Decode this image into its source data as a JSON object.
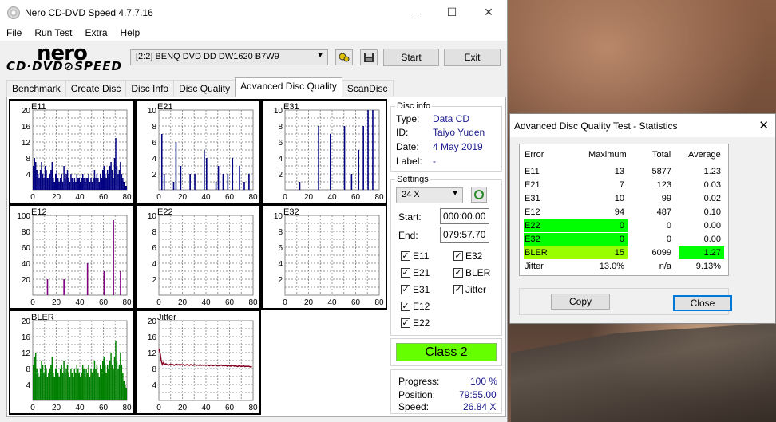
{
  "app": {
    "title": "Nero CD-DVD Speed 4.7.7.16",
    "min": "—",
    "max": "☐",
    "close": "✕"
  },
  "menu": [
    "File",
    "Run Test",
    "Extra",
    "Help"
  ],
  "logo": {
    "top": "nero",
    "bottom": "CD·DVD⊘SPEED"
  },
  "toolbar": {
    "drive": "[2:2]   BENQ DVD DD DW1620 B7W9",
    "start": "Start",
    "exit": "Exit"
  },
  "tabs": [
    "Benchmark",
    "Create Disc",
    "Disc Info",
    "Disc Quality",
    "Advanced Disc Quality",
    "ScanDisc"
  ],
  "active_tab": "Advanced Disc Quality",
  "disc_info": {
    "title": "Disc info",
    "type_label": "Type:",
    "type": "Data CD",
    "id_label": "ID:",
    "id": "Taiyo Yuden",
    "date_label": "Date:",
    "date": "4 May 2019",
    "label_label": "Label:",
    "label": "-"
  },
  "settings": {
    "title": "Settings",
    "speed": "24 X",
    "start_label": "Start:",
    "start": "000:00.00",
    "end_label": "End:",
    "end": "079:57.70",
    "checks": {
      "e11": "E11",
      "e21": "E21",
      "e31": "E31",
      "e12": "E12",
      "e22": "E22",
      "e32": "E32",
      "bler": "BLER",
      "jitter": "Jitter"
    }
  },
  "class_label": "Class 2",
  "progress": {
    "progress_label": "Progress:",
    "progress": "100 %",
    "position_label": "Position:",
    "position": "79:55.00",
    "speed_label": "Speed:",
    "speed": "26.84 X"
  },
  "stats": {
    "title": "Advanced Disc Quality Test - Statistics",
    "headers": [
      "Error",
      "Maximum",
      "Total",
      "Average"
    ],
    "rows": [
      {
        "name": "E11",
        "max": "13",
        "total": "5877",
        "avg": "1.23",
        "hl": ""
      },
      {
        "name": "E21",
        "max": "7",
        "total": "123",
        "avg": "0.03",
        "hl": ""
      },
      {
        "name": "E31",
        "max": "10",
        "total": "99",
        "avg": "0.02",
        "hl": ""
      },
      {
        "name": "E12",
        "max": "94",
        "total": "487",
        "avg": "0.10",
        "hl": ""
      },
      {
        "name": "E22",
        "max": "0",
        "total": "0",
        "avg": "0.00",
        "hl": "name-max"
      },
      {
        "name": "E32",
        "max": "0",
        "total": "0",
        "avg": "0.00",
        "hl": "name-max"
      },
      {
        "name": "BLER",
        "max": "15",
        "total": "6099",
        "avg": "1.27",
        "hl": "bler"
      },
      {
        "name": "Jitter",
        "max": "13.0%",
        "total": "n/a",
        "avg": "9.13%",
        "hl": ""
      }
    ],
    "copy": "Copy",
    "close": "Close"
  },
  "chart_data": [
    {
      "type": "bar",
      "name": "E11",
      "x_ticks": [
        0,
        20,
        40,
        60,
        80
      ],
      "y_ticks": [
        4,
        8,
        12,
        16,
        20
      ],
      "ylim": [
        0,
        20
      ],
      "color": "#000080",
      "values": [
        6,
        8,
        7,
        5,
        4,
        3,
        5,
        7,
        4,
        3,
        6,
        5,
        3,
        3,
        4,
        5,
        7,
        3,
        2,
        4,
        5,
        3,
        2,
        3,
        4,
        2,
        6,
        3,
        4,
        5,
        3,
        2,
        4,
        3,
        2,
        3,
        2,
        4,
        3,
        3,
        2,
        3,
        4,
        3,
        2,
        3,
        3,
        4,
        2,
        3,
        2,
        3,
        5,
        3,
        4,
        3,
        2,
        4,
        3,
        5,
        6,
        4,
        3,
        5,
        4,
        6,
        7,
        5,
        3,
        8,
        13,
        6,
        4,
        5,
        7,
        4,
        3,
        2,
        1,
        1
      ]
    },
    {
      "type": "bar",
      "name": "E21",
      "x_ticks": [
        0,
        20,
        40,
        60,
        80
      ],
      "y_ticks": [
        2,
        4,
        6,
        8,
        10
      ],
      "ylim": [
        0,
        10
      ],
      "color": "#000080",
      "spikes": [
        [
          2,
          7
        ],
        [
          4,
          2
        ],
        [
          12,
          1
        ],
        [
          14,
          6
        ],
        [
          18,
          3
        ],
        [
          26,
          2
        ],
        [
          30,
          2
        ],
        [
          38,
          5
        ],
        [
          40,
          4
        ],
        [
          48,
          1
        ],
        [
          50,
          3
        ],
        [
          54,
          2
        ],
        [
          58,
          2
        ],
        [
          62,
          4
        ],
        [
          68,
          3
        ],
        [
          72,
          1
        ],
        [
          76,
          2
        ]
      ]
    },
    {
      "type": "bar",
      "name": "E31",
      "x_ticks": [
        0,
        20,
        40,
        60,
        80
      ],
      "y_ticks": [
        2,
        4,
        6,
        8,
        10
      ],
      "ylim": [
        0,
        10
      ],
      "color": "#000080",
      "spikes": [
        [
          12,
          1
        ],
        [
          28,
          8
        ],
        [
          38,
          7
        ],
        [
          50,
          8
        ],
        [
          56,
          2
        ],
        [
          62,
          5
        ],
        [
          66,
          8
        ],
        [
          70,
          10
        ],
        [
          74,
          10
        ]
      ]
    },
    {
      "type": "bar",
      "name": "E12",
      "x_ticks": [
        0,
        20,
        40,
        60,
        80
      ],
      "y_ticks": [
        20,
        40,
        60,
        80,
        100
      ],
      "ylim": [
        0,
        100
      ],
      "color": "#800080",
      "spikes": [
        [
          12,
          20
        ],
        [
          26,
          20
        ],
        [
          46,
          40
        ],
        [
          60,
          30
        ],
        [
          68,
          94
        ],
        [
          74,
          30
        ]
      ]
    },
    {
      "type": "bar",
      "name": "E22",
      "x_ticks": [
        0,
        20,
        40,
        60,
        80
      ],
      "y_ticks": [
        2,
        4,
        6,
        8,
        10
      ],
      "ylim": [
        0,
        10
      ],
      "color": "#000080",
      "spikes": []
    },
    {
      "type": "bar",
      "name": "E32",
      "x_ticks": [
        0,
        20,
        40,
        60,
        80
      ],
      "y_ticks": [
        2,
        4,
        6,
        8,
        10
      ],
      "ylim": [
        0,
        10
      ],
      "color": "#000080",
      "spikes": []
    },
    {
      "type": "bar",
      "name": "BLER",
      "x_ticks": [
        0,
        20,
        40,
        60,
        80
      ],
      "y_ticks": [
        4,
        8,
        12,
        16,
        20
      ],
      "ylim": [
        0,
        20
      ],
      "color": "#008000",
      "values": [
        9,
        11,
        12,
        8,
        7,
        6,
        8,
        10,
        9,
        7,
        9,
        8,
        6,
        7,
        8,
        9,
        11,
        7,
        6,
        8,
        9,
        7,
        6,
        8,
        9,
        7,
        10,
        7,
        8,
        9,
        7,
        6,
        8,
        7,
        6,
        8,
        7,
        9,
        8,
        7,
        6,
        7,
        9,
        8,
        6,
        8,
        7,
        9,
        6,
        8,
        7,
        8,
        10,
        8,
        9,
        7,
        6,
        9,
        8,
        10,
        11,
        9,
        7,
        9,
        8,
        10,
        12,
        9,
        8,
        11,
        15,
        10,
        8,
        9,
        12,
        9,
        7,
        5,
        4,
        3
      ]
    },
    {
      "type": "line",
      "name": "Jitter",
      "x_ticks": [
        0,
        20,
        40,
        60,
        80
      ],
      "y_ticks": [
        4,
        8,
        12,
        16,
        20
      ],
      "ylim": [
        0,
        20
      ],
      "color": "#800020",
      "values": [
        13,
        12,
        10,
        9,
        9.5,
        9,
        9.2,
        9,
        8.8,
        9,
        9.1,
        8.9,
        9,
        8.8,
        9,
        9.1,
        8.9,
        9,
        8.8,
        9,
        8.9,
        9,
        8.8,
        8.9,
        9,
        8.9,
        8.8,
        9,
        8.9,
        8.8,
        9,
        8.9,
        8.8,
        8.9,
        8.8,
        9,
        8.8,
        8.9,
        8.8,
        8.9,
        8.8,
        8.9,
        8.8,
        8.7,
        8.9,
        8.8,
        8.7,
        8.8,
        8.9,
        8.7,
        8.8,
        8.7,
        8.8,
        8.9,
        8.7,
        8.8,
        8.7,
        8.8,
        8.6,
        8.7,
        8.8,
        8.6,
        8.7,
        8.8,
        8.6,
        8.7,
        8.6,
        8.5,
        8.7,
        8.6,
        8.5,
        8.6,
        8.7,
        8.5,
        8.6,
        8.5,
        8.6,
        8.5,
        8.4,
        8.5
      ]
    }
  ]
}
